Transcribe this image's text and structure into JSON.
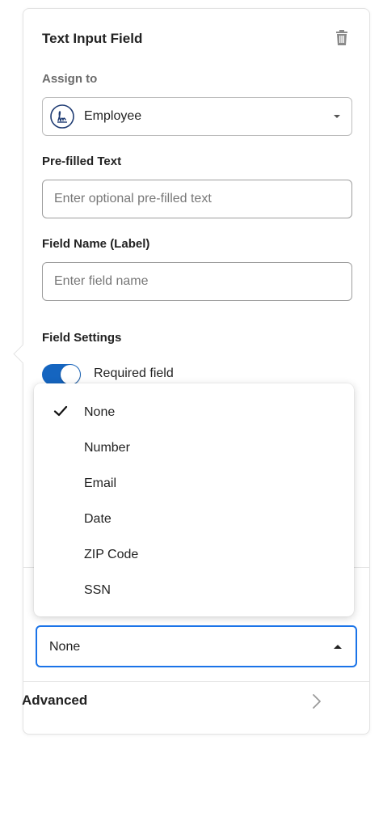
{
  "panel": {
    "title": "Text Input Field"
  },
  "assign": {
    "label": "Assign to",
    "value": "Employee"
  },
  "prefilled": {
    "label": "Pre-filled Text",
    "placeholder": "Enter optional pre-filled text"
  },
  "field_name": {
    "label": "Field Name (Label)",
    "placeholder": "Enter field name"
  },
  "settings": {
    "label": "Field Settings",
    "required_label": "Required field",
    "required_on": true
  },
  "validation_menu": {
    "options": [
      "None",
      "Number",
      "Email",
      "Date",
      "ZIP Code",
      "SSN"
    ],
    "selected": "None"
  },
  "validation_select": {
    "value": "None"
  },
  "advanced": {
    "label": "Advanced"
  },
  "colors": {
    "accent": "#1a73e8",
    "toggle_on": "#1565c0"
  },
  "icons": {
    "delete": "trash-icon",
    "assignee": "signature-icon",
    "dropdown": "caret-down-icon",
    "check": "check-icon",
    "open_dropdown": "caret-up-icon",
    "advanced": "chevron-right-icon"
  }
}
